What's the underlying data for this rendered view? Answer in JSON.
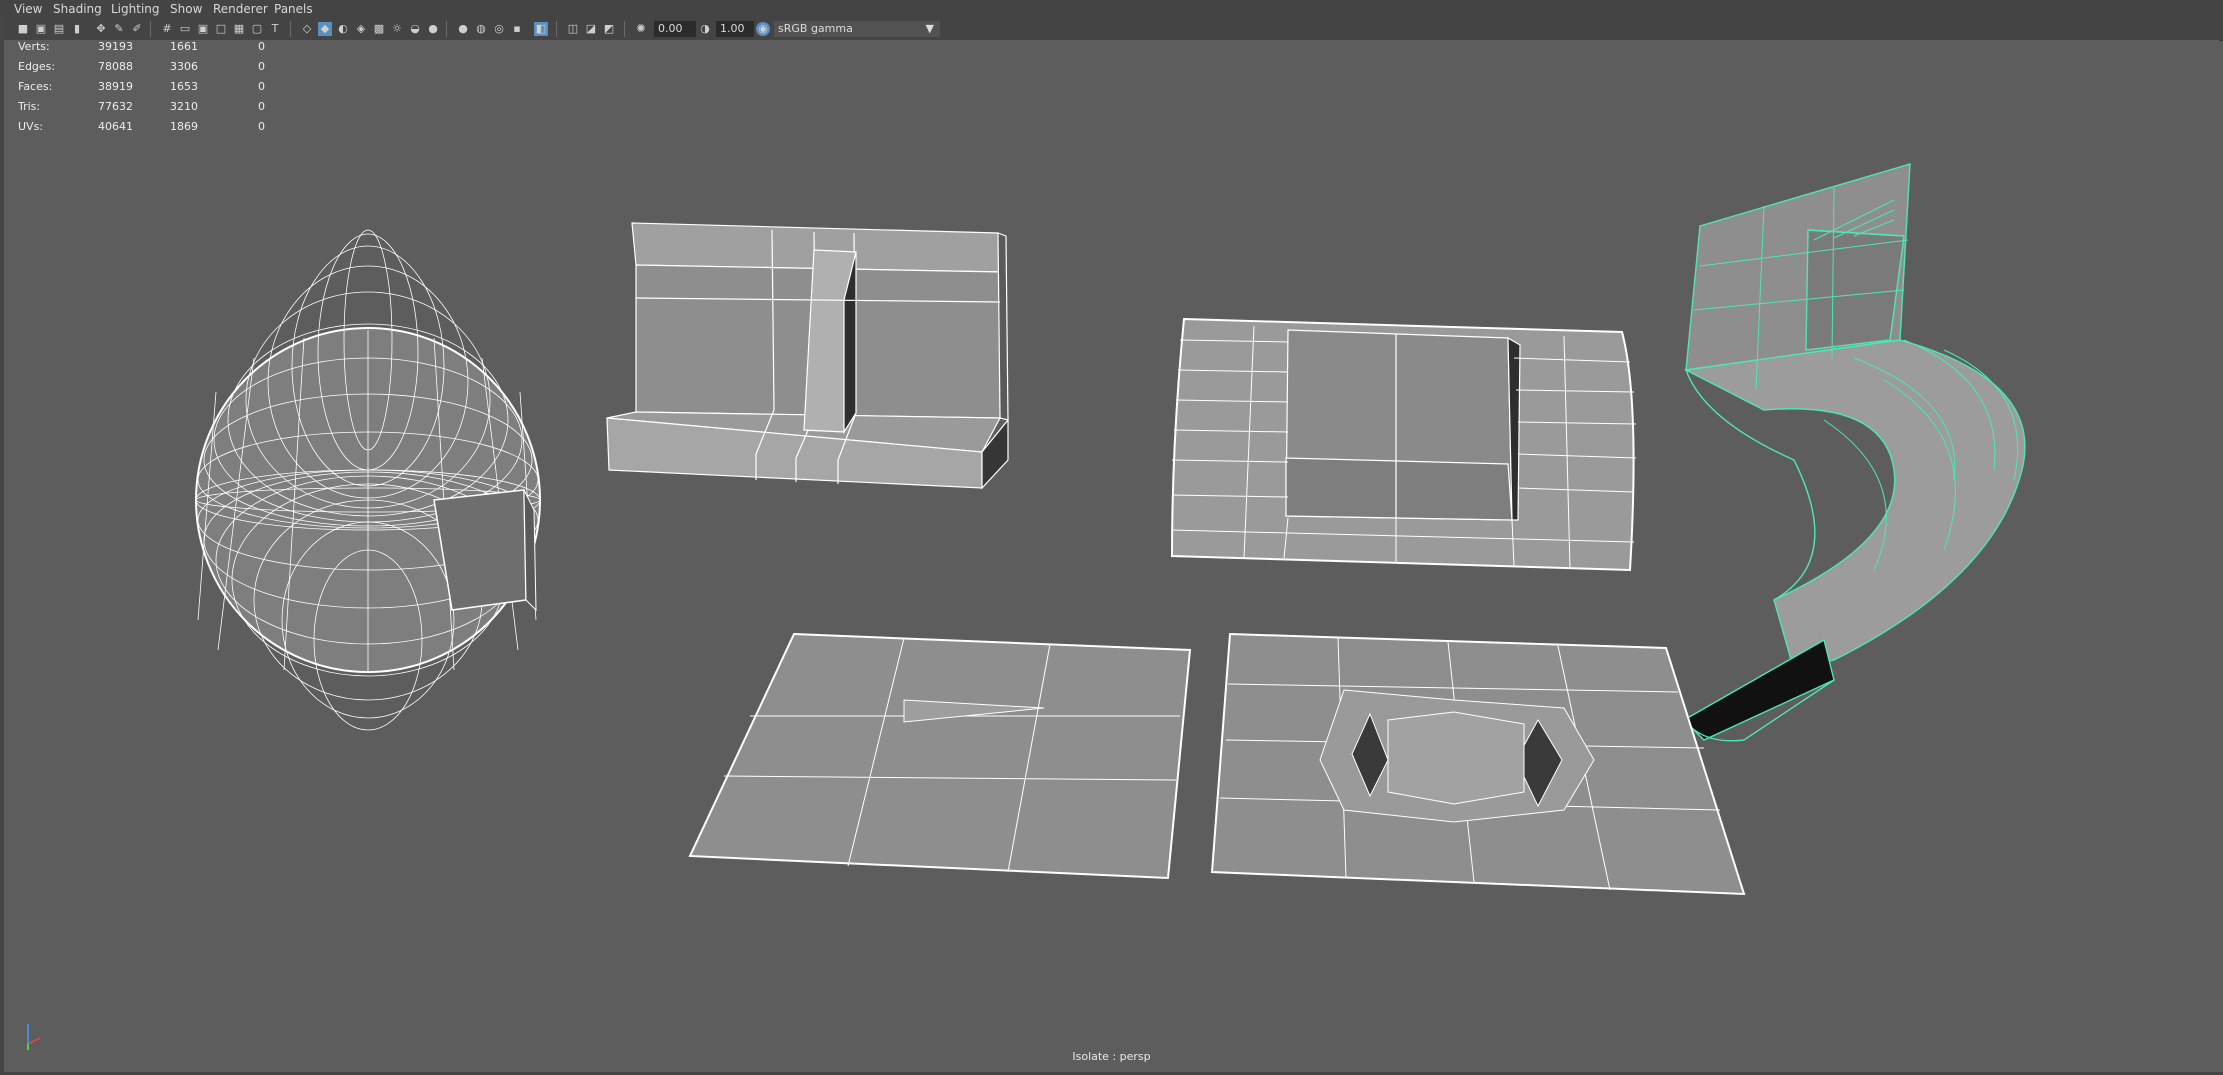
{
  "menubar": {
    "items": [
      "View",
      "Shading",
      "Lighting",
      "Show",
      "Renderer",
      "Panels"
    ]
  },
  "toolbar": {
    "exposure_value": "0.00",
    "gamma_value": "1.00",
    "color_space": "sRGB gamma"
  },
  "hud": {
    "rows": [
      {
        "label": "Verts:",
        "total": "39193",
        "selected": "1661",
        "extra": "0"
      },
      {
        "label": "Edges:",
        "total": "78088",
        "selected": "3306",
        "extra": "0"
      },
      {
        "label": "Faces:",
        "total": "38919",
        "selected": "1653",
        "extra": "0"
      },
      {
        "label": "Tris:",
        "total": "77632",
        "selected": "3210",
        "extra": "0"
      },
      {
        "label": "UVs:",
        "total": "40641",
        "selected": "1869",
        "extra": "0"
      }
    ]
  },
  "viewport": {
    "status_text": "Isolate : persp",
    "selection_color": "#4de8b0",
    "wire_color": "#ffffff",
    "background_color": "#5d5d5d"
  },
  "axis_indicator": {
    "x": "x",
    "y": "y",
    "z": "z"
  }
}
